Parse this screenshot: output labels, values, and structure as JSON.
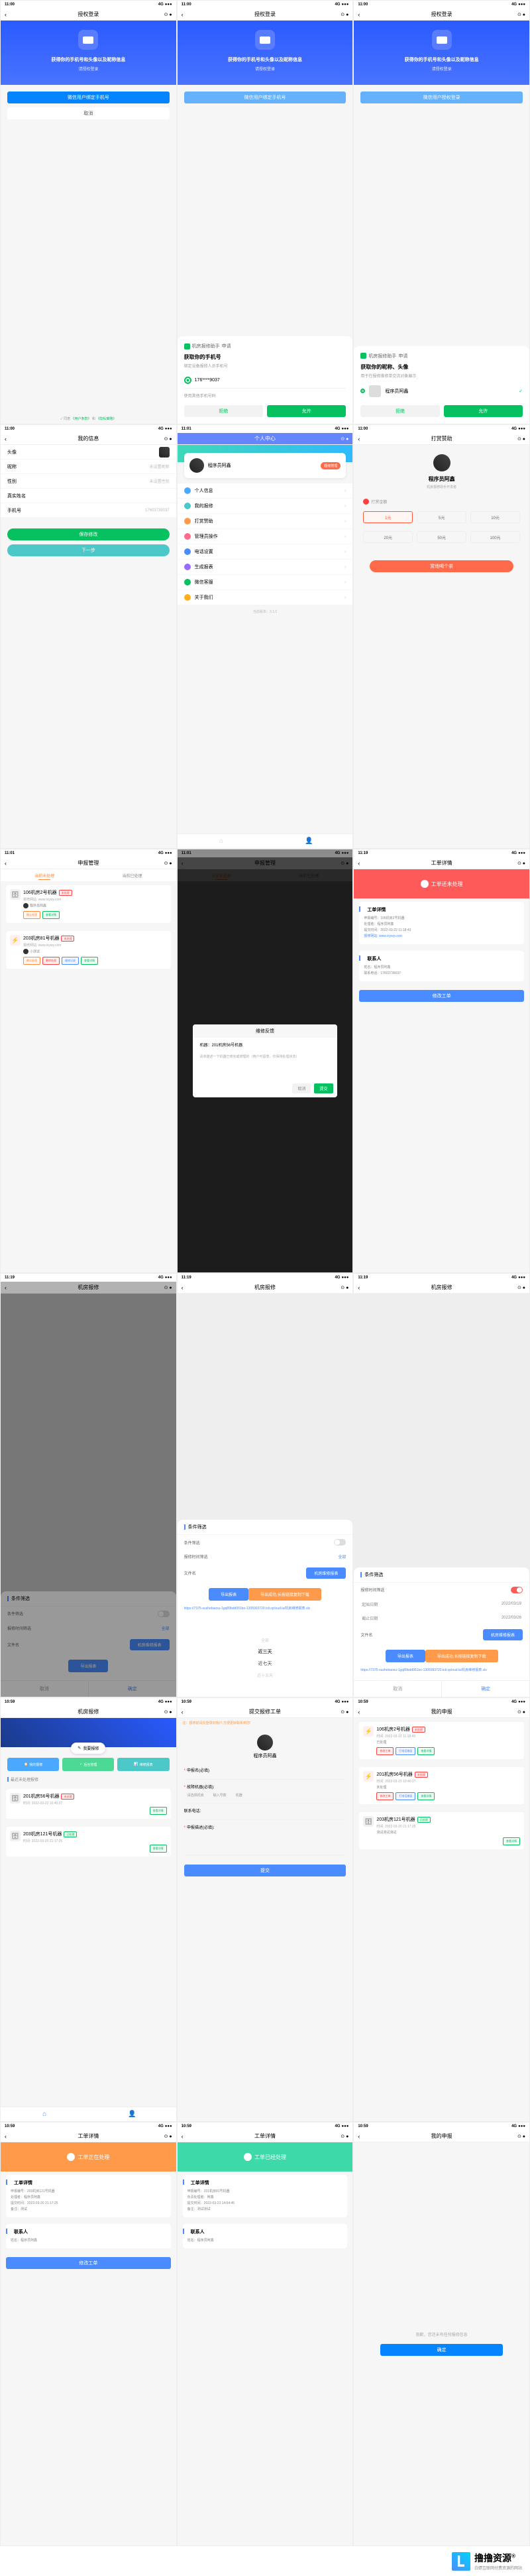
{
  "status": {
    "time": "11:00",
    "time2": "11:01",
    "time3": "11:19",
    "time4": "10:59",
    "signal": "4G"
  },
  "auth": {
    "title": "授权登录",
    "headline": "获得你的手机号和头像以及昵称信息",
    "sub": "请授权登录",
    "btn_bind": "微信用户绑定手机号",
    "btn_cancel": "取消",
    "btn_bind2": "微信用户授权登录",
    "agree_pre": "同意",
    "terms": "《用户条款》",
    "and": "和",
    "privacy": "《隐私策略》"
  },
  "popup_phone": {
    "app": "机房报修助手",
    "apply": "申请",
    "title": "获取你的手机号",
    "desc": "绑定设备报修人员手机号",
    "phone": "176****9037",
    "other": "使用其他手机号码",
    "reject": "拒绝",
    "allow": "允许"
  },
  "popup_profile": {
    "app": "机房报修助手",
    "apply": "申请",
    "title": "获取你的昵称、头像",
    "desc": "用于在报修维修单交流对象展示",
    "name": "程序员阿鑫",
    "reject": "拒绝",
    "allow": "允许"
  },
  "profile": {
    "title": "我的信息",
    "rows": {
      "avatar": "头像",
      "nick": "昵称",
      "nick_ph": "未设置昵称",
      "gender": "性别",
      "gender_ph": "未设置性别",
      "real": "真实姓名",
      "phone": "手机号",
      "phone_v": "17603739037"
    },
    "save": "保存修改",
    "next": "下一步"
  },
  "center": {
    "title": "个人中心",
    "name": "程序员阿鑫",
    "badge": "超级管理",
    "ver": "当前版本：3.1.0",
    "items": [
      {
        "c": "#4aa8ff",
        "t": "个人信息"
      },
      {
        "c": "#4cc8c8",
        "t": "我的报修"
      },
      {
        "c": "#ff9a4a",
        "t": "打赏赞助"
      },
      {
        "c": "#ff6b8a",
        "t": "管理员操作"
      },
      {
        "c": "#4a8cff",
        "t": "电话设置"
      },
      {
        "c": "#9a6bff",
        "t": "生成报表"
      },
      {
        "c": "#06c160",
        "t": "微信客服"
      },
      {
        "c": "#ffb020",
        "t": "关于我们"
      }
    ]
  },
  "reward": {
    "title": "打赏赞助",
    "name": "程序员阿鑫",
    "sub": "机房报修助手开发者",
    "label": "打赏金额",
    "amts": [
      "1元",
      "5元",
      "10元",
      "20元",
      "50元",
      "100元"
    ],
    "btn": "赏他喝个茶"
  },
  "manage": {
    "title": "申报管理",
    "tabs": [
      "当前未处理",
      "当前已处理"
    ],
    "c1": {
      "t": "106机房2号机器",
      "badge": "未处理",
      "u": "报修网站: www.ixywy.com",
      "who": "程序员阿鑫",
      "ops": [
        "确认处理",
        "查看详情"
      ]
    },
    "c2": {
      "t": "203机房81号机器",
      "badge": "未处理",
      "u": "报修网站: www.ixywy.com",
      "who": "小测试",
      "ops": [
        "确认处理",
        "删除处理",
        "维修记录",
        "查看详情"
      ]
    }
  },
  "feedback": {
    "title": "维修反馈",
    "machine": "机器：201机房56号机器",
    "ph": "请单描述一下机器已修完或修理的（用户可留意，仅保持处理状态）",
    "cancel": "取消",
    "confirm": "提交"
  },
  "detail_notstart": {
    "title": "工单详情",
    "status": "工单还未处理",
    "h": "工单详情",
    "n": "申报编号：106机房2号机器",
    "who": "处理者：程序员阿鑫",
    "time": "提交时间：2022-03-22 11:18:43",
    "site": "报修网站: www.ixywy.com",
    "c": "联系人",
    "cn": "姓名：程序员阿鑫",
    "cp": "联系电话：17603739037",
    "btn": "修改工单"
  },
  "filter": {
    "title": "机房报修",
    "h": "条件筛选",
    "r1": "条件筛选",
    "r2": "报修时间筛选",
    "all": "全部",
    "r3": "文件名",
    "fname": "机房维修报表",
    "export": "导出报表",
    "tip": "导出成功,长按链接复制下载",
    "cancel": "取消",
    "ok": "确定",
    "dates": [
      "全部",
      "近三天",
      "近七天",
      "近十五天"
    ],
    "start": "起始日期",
    "start_v": "2022/03/19",
    "end": "截止日期",
    "end_v": "2022/03/26",
    "link1": "https://7375-sushebaoxu-1gq89bdd051bo-1305993720.tcb.qcloud.la/机房维修报表.xls",
    "link2": "https://7375-sushebaoxu-1gq89bdd051bo-1305993720.tcb.qcloud.la/机房维修报表.xls"
  },
  "home": {
    "title": "机房报修",
    "float": "我要报修",
    "q": [
      "我的报修",
      "后台管理",
      "维修报表"
    ],
    "sec": "最近未处理报修",
    "c1": {
      "t": "201机房56号机器",
      "badge": "未处理",
      "d": "时间: 2022-03-22 10:40:27",
      "op": "查看详情"
    },
    "c2": {
      "t": "203机房121号机器",
      "badge": "已处理",
      "d": "时间: 2022-03-20 21:17:25",
      "op": "查看详情"
    }
  },
  "submit": {
    "title": "提交报修工单",
    "tip": "注：报修前请先登录好账户,方便更好联系到您!",
    "name": "程序员阿鑫",
    "f1": "申报名(必填)",
    "f2": "故障机器(必填):",
    "f2p": "请选择机房  某几号某机器  机器",
    "f3": "联系电话:",
    "f4": "申报描述(必填):",
    "btn": "提交"
  },
  "mine": {
    "title": "我的申报",
    "c1": {
      "t": "106机房2号机器",
      "badge": "未处理",
      "d": "时间: 2022-03-22 11:18:43",
      "st": "已处理",
      "ops": [
        "修改工单",
        "打电话催促",
        "查看详情"
      ]
    },
    "c2": {
      "t": "201机房56号机器",
      "badge": "未处理",
      "d": "时间: 2022-03-22 10:40:27",
      "st": "未处理",
      "ops": [
        "修改工单",
        "打电话催促",
        "查看详情"
      ]
    },
    "c3": {
      "t": "203机房121号机器",
      "badge": "已处理",
      "d": "时间: 2022-03-20 21:17:25",
      "st": "测试测试测试",
      "ops": [
        "查看详情"
      ]
    }
  },
  "detail_ing": {
    "title": "工单详情",
    "status": "工单正在处理",
    "h": "工单详情",
    "n": "申报编号：203机房121号机器",
    "who": "处理者：程序员阿鑫",
    "time": "提交时间：2022-03-20 21:17:25",
    "remark": "备注：测试",
    "c": "联系人",
    "cn": "姓名：程序员阿鑫",
    "btn": "修改工单"
  },
  "detail_done": {
    "title": "工单详情",
    "status": "工单已经处理",
    "h": "工单详情",
    "n": "申报编号：201机房81号机器",
    "who": "负责处理者：阿鑫",
    "time": "提交时间：2022-03-23 14:54:45",
    "remark": "备注：测试测试",
    "c": "联系人",
    "cn": "姓名：程序员阿鑫"
  },
  "empty": {
    "title": "我的申报",
    "msg": "抱歉，您还未有任何报修信息",
    "btn": "确定"
  },
  "brand": {
    "name": "撸撸资源",
    "reg": "®",
    "sub": "白嫖互联网付费资源的网站"
  }
}
